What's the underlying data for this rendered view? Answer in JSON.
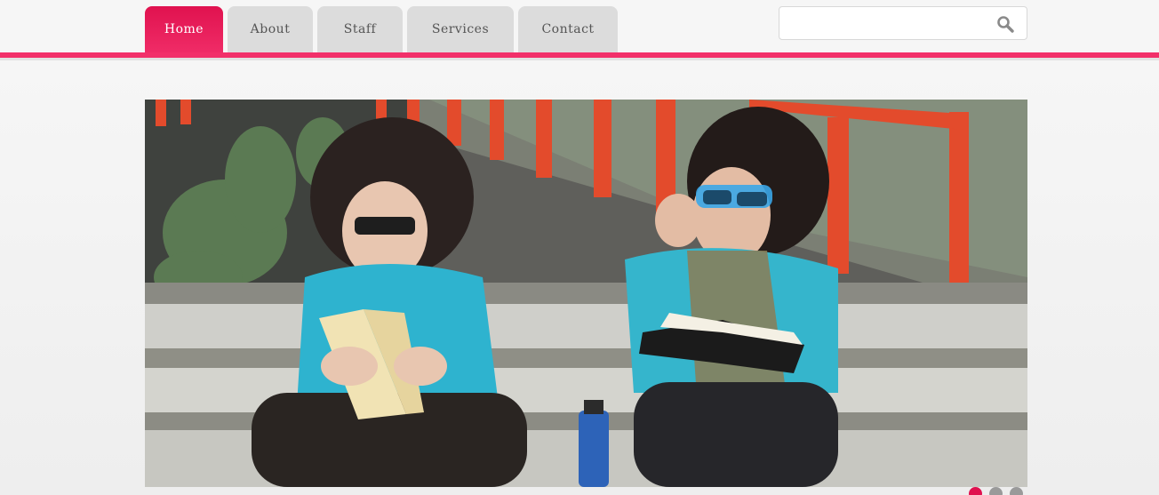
{
  "nav": {
    "tabs": [
      {
        "label": "Home",
        "active": true
      },
      {
        "label": "About",
        "active": false
      },
      {
        "label": "Staff",
        "active": false
      },
      {
        "label": "Services",
        "active": false
      },
      {
        "label": "Contact",
        "active": false
      }
    ]
  },
  "search": {
    "value": "",
    "placeholder": "",
    "icon": "search-icon"
  },
  "slider": {
    "image_icon": "photo-two-women-reading-on-steps",
    "slide_count": 3,
    "active_slide": 1
  },
  "colors": {
    "accent": "#f2306a",
    "accent_dark": "#e0124f",
    "tab_inactive": "#dcdcdc",
    "dot_inactive": "#9a9a9a"
  }
}
